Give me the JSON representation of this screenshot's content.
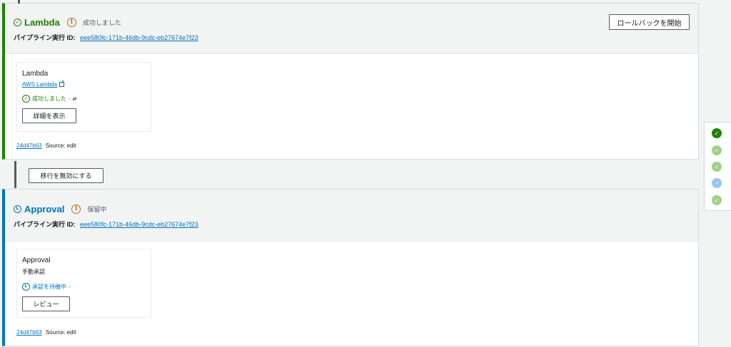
{
  "stages": {
    "lambda": {
      "name": "Lambda",
      "status": "成功しました",
      "exec_label": "パイプライン実行 ID:",
      "exec_id": "eee580fc-171b-46db-9cdc-eb27674e7f23",
      "rollback_label": "ロールバックを開始",
      "action": {
        "name": "Lambda",
        "provider": "AWS Lambda",
        "status": "成功しました",
        "status_suffix": "-",
        "button_label": "詳細を表示"
      },
      "source_commit": "24d47b63",
      "source_text": "Source: edit"
    },
    "approval": {
      "name": "Approval",
      "status": "保留中",
      "exec_label": "パイプライン実行 ID:",
      "exec_id": "eee580fc-171b-46db-9cdc-eb27674e7f23",
      "action": {
        "name": "Approval",
        "sub": "手動承認",
        "status": "承認を待機中",
        "status_suffix": "-",
        "button_label": "レビュー"
      },
      "source_commit": "24d47b63",
      "source_text": "Source: edit"
    }
  },
  "transition": {
    "button_label": "移行を無効にする"
  },
  "timeline": {
    "steps": [
      "succeeded-current",
      "succeeded",
      "succeeded",
      "in-progress",
      "succeeded"
    ]
  },
  "colors": {
    "success": "#1d8102",
    "pending": "#0073bb",
    "link": "#0073bb",
    "info": "#b7740f"
  }
}
